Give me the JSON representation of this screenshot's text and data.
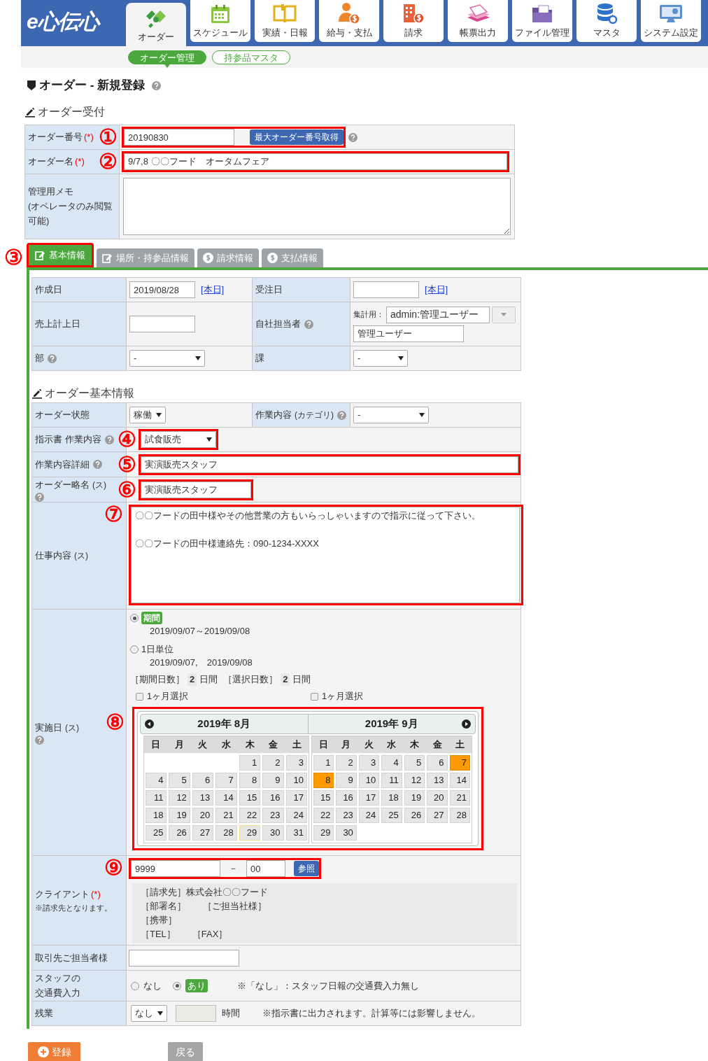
{
  "header": {
    "logo": "e心伝心",
    "nav": [
      {
        "label": "オーダー",
        "selected": true
      },
      {
        "label": "スケジュール",
        "selected": false
      },
      {
        "label": "実績・日報",
        "selected": false
      },
      {
        "label": "給与・支払",
        "selected": false
      },
      {
        "label": "請求",
        "selected": false
      },
      {
        "label": "帳票出力",
        "selected": false
      },
      {
        "label": "ファイル管理",
        "selected": false
      },
      {
        "label": "マスタ",
        "selected": false
      },
      {
        "label": "システム設定",
        "selected": false
      }
    ]
  },
  "subnav": [
    {
      "label": "オーダー管理",
      "selected": true
    },
    {
      "label": "持参品マスタ",
      "selected": false
    }
  ],
  "title": {
    "text": "オーダー - 新規登録",
    "help": true
  },
  "reception": {
    "heading": "オーダー受付",
    "rows": [
      {
        "kind": "number",
        "label": "オーダー番号",
        "required": "(*)",
        "callout": "①",
        "value": "20190830",
        "button": "最大オーダー番号取得",
        "value_help": true
      },
      {
        "kind": "input",
        "label": "オーダー名",
        "required": "(*)",
        "callout": "②",
        "value": "9/7,8 〇〇フード　オータムフェア"
      },
      {
        "kind": "textarea",
        "label": [
          "管理用メモ",
          "(オペレータのみ閲覧",
          "可能)"
        ]
      }
    ]
  },
  "tabs": [
    {
      "label": "基本情報",
      "selected": true,
      "kind": "edit",
      "callout": "③"
    },
    {
      "label": "場所・持参品情報",
      "selected": false,
      "kind": "edit"
    },
    {
      "label": "請求情報",
      "selected": false,
      "kind": "money"
    },
    {
      "label": "支払情報",
      "selected": false,
      "kind": "money"
    }
  ],
  "basic": {
    "rows": [
      [
        {
          "label": "作成日",
          "field": {
            "kind": "date",
            "value": "2019/08/28",
            "link": "[本日]"
          }
        },
        {
          "label": "受注日",
          "field": {
            "kind": "date",
            "link": "[本日]"
          }
        }
      ],
      [
        {
          "label": "売上計上日",
          "field": {
            "kind": "input"
          }
        },
        {
          "label": "自社担当者",
          "help": true,
          "field": {
            "kind": "staff",
            "prefix": "集計用：",
            "select": "admin:管理ユーザー",
            "value": "管理ユーザー"
          }
        }
      ],
      [
        {
          "label": "部",
          "help": true,
          "field": {
            "kind": "select",
            "value": "-"
          }
        },
        {
          "label": "課",
          "field": {
            "kind": "select",
            "value": "-"
          }
        }
      ]
    ]
  },
  "detail": {
    "heading": "オーダー基本情報",
    "rows": [
      {
        "kind": "pair",
        "cells": [
          {
            "label": "オーダー状態",
            "field": {
              "kind": "select",
              "value": "稼働"
            }
          },
          {
            "label": "作業内容",
            "note": "(カテゴリ)",
            "help": true,
            "field": {
              "kind": "select",
              "value": "-"
            }
          }
        ]
      },
      {
        "kind": "select",
        "label": "指示書 作業内容",
        "help": true,
        "callout": "④",
        "value": "試食販売"
      },
      {
        "kind": "input",
        "label": "作業内容詳細",
        "help": true,
        "callout": "⑤",
        "value": "実演販売スタッフ"
      },
      {
        "kind": "input",
        "label": "オーダー略名",
        "note": "(ス)",
        "help": true,
        "callout": "⑥",
        "value": "実演販売スタッフ"
      },
      {
        "kind": "textarea",
        "label": "仕事内容",
        "note": "(ス)",
        "callout": "⑦",
        "lines": [
          "〇〇フードの田中様やその他営業の方もいらっしゃいますので指示に従って下さい。",
          "〇〇フードの田中様連絡先：090-1234-XXXX"
        ]
      },
      {
        "kind": "schedule",
        "label": "実施日",
        "note": "(ス)",
        "help": true,
        "callout": "⑧",
        "options": [
          {
            "label": "期間",
            "selected": true,
            "dates": "2019/09/07～2019/09/08"
          },
          {
            "label": "1日単位",
            "selected": false,
            "dates": "2019/09/07,　2019/09/08"
          }
        ],
        "counts": [
          {
            "label": "［期間日数］",
            "value": "2",
            "unit": "日間"
          },
          {
            "label": "［選択日数］",
            "value": "2",
            "unit": "日間"
          }
        ],
        "month_checks": [
          {
            "label": "1ヶ月選択",
            "checked": false
          },
          {
            "label": "1ヶ月選択",
            "checked": false
          }
        ],
        "calendar": {
          "months": [
            {
              "title": "2019年 8月",
              "weekdays": [
                "日",
                "月",
                "火",
                "水",
                "木",
                "金",
                "土"
              ],
              "weeks": [
                {
                  "right_aligned": true,
                  "days": [
                    {
                      "d": "1",
                      "selected": false,
                      "today": false
                    },
                    {
                      "d": "2",
                      "selected": false,
                      "today": false
                    },
                    {
                      "d": "3",
                      "selected": false,
                      "today": false
                    }
                  ]
                },
                {
                  "days": [
                    {
                      "d": "4",
                      "selected": false,
                      "today": false
                    },
                    {
                      "d": "5",
                      "selected": false,
                      "today": false
                    },
                    {
                      "d": "6",
                      "selected": false,
                      "today": false
                    },
                    {
                      "d": "7",
                      "selected": false,
                      "today": false
                    },
                    {
                      "d": "8",
                      "selected": false,
                      "today": false
                    },
                    {
                      "d": "9",
                      "selected": false,
                      "today": false
                    },
                    {
                      "d": "10",
                      "selected": false,
                      "today": false
                    }
                  ]
                },
                {
                  "days": [
                    {
                      "d": "11",
                      "selected": false,
                      "today": false
                    },
                    {
                      "d": "12",
                      "selected": false,
                      "today": false
                    },
                    {
                      "d": "13",
                      "selected": false,
                      "today": false
                    },
                    {
                      "d": "14",
                      "selected": false,
                      "today": false
                    },
                    {
                      "d": "15",
                      "selected": false,
                      "today": false
                    },
                    {
                      "d": "16",
                      "selected": false,
                      "today": false
                    },
                    {
                      "d": "17",
                      "selected": false,
                      "today": false
                    }
                  ]
                },
                {
                  "days": [
                    {
                      "d": "18",
                      "selected": false,
                      "today": false
                    },
                    {
                      "d": "19",
                      "selected": false,
                      "today": false
                    },
                    {
                      "d": "20",
                      "selected": false,
                      "today": false
                    },
                    {
                      "d": "21",
                      "selected": false,
                      "today": false
                    },
                    {
                      "d": "22",
                      "selected": false,
                      "today": false
                    },
                    {
                      "d": "23",
                      "selected": false,
                      "today": false
                    },
                    {
                      "d": "24",
                      "selected": false,
                      "today": false
                    }
                  ]
                },
                {
                  "days": [
                    {
                      "d": "25",
                      "selected": false,
                      "today": false
                    },
                    {
                      "d": "26",
                      "selected": false,
                      "today": false
                    },
                    {
                      "d": "27",
                      "selected": false,
                      "today": false
                    },
                    {
                      "d": "28",
                      "selected": false,
                      "today": false
                    },
                    {
                      "d": "29",
                      "selected": false,
                      "today": true
                    },
                    {
                      "d": "30",
                      "selected": false,
                      "today": false
                    },
                    {
                      "d": "31",
                      "selected": false,
                      "today": false
                    }
                  ]
                }
              ]
            },
            {
              "title": "2019年 9月",
              "weekdays": [
                "日",
                "月",
                "火",
                "水",
                "木",
                "金",
                "土"
              ],
              "weeks": [
                {
                  "days": [
                    {
                      "d": "1",
                      "selected": false,
                      "today": false
                    },
                    {
                      "d": "2",
                      "selected": false,
                      "today": false
                    },
                    {
                      "d": "3",
                      "selected": false,
                      "today": false
                    },
                    {
                      "d": "4",
                      "selected": false,
                      "today": false
                    },
                    {
                      "d": "5",
                      "selected": false,
                      "today": false
                    },
                    {
                      "d": "6",
                      "selected": false,
                      "today": false
                    },
                    {
                      "d": "7",
                      "selected": true,
                      "today": false
                    }
                  ]
                },
                {
                  "days": [
                    {
                      "d": "8",
                      "selected": true,
                      "today": false
                    },
                    {
                      "d": "9",
                      "selected": false,
                      "today": false
                    },
                    {
                      "d": "10",
                      "selected": false,
                      "today": false
                    },
                    {
                      "d": "11",
                      "selected": false,
                      "today": false
                    },
                    {
                      "d": "12",
                      "selected": false,
                      "today": false
                    },
                    {
                      "d": "13",
                      "selected": false,
                      "today": false
                    },
                    {
                      "d": "14",
                      "selected": false,
                      "today": false
                    }
                  ]
                },
                {
                  "days": [
                    {
                      "d": "15",
                      "selected": false,
                      "today": false
                    },
                    {
                      "d": "16",
                      "selected": false,
                      "today": false
                    },
                    {
                      "d": "17",
                      "selected": false,
                      "today": false
                    },
                    {
                      "d": "18",
                      "selected": false,
                      "today": false
                    },
                    {
                      "d": "19",
                      "selected": false,
                      "today": false
                    },
                    {
                      "d": "20",
                      "selected": false,
                      "today": false
                    },
                    {
                      "d": "21",
                      "selected": false,
                      "today": false
                    }
                  ]
                },
                {
                  "days": [
                    {
                      "d": "22",
                      "selected": false,
                      "today": false
                    },
                    {
                      "d": "23",
                      "selected": false,
                      "today": false
                    },
                    {
                      "d": "24",
                      "selected": false,
                      "today": false
                    },
                    {
                      "d": "25",
                      "selected": false,
                      "today": false
                    },
                    {
                      "d": "26",
                      "selected": false,
                      "today": false
                    },
                    {
                      "d": "27",
                      "selected": false,
                      "today": false
                    },
                    {
                      "d": "28",
                      "selected": false,
                      "today": false
                    }
                  ]
                },
                {
                  "right_aligned": false,
                  "days": [
                    {
                      "d": "29",
                      "selected": false,
                      "today": false
                    },
                    {
                      "d": "30",
                      "selected": false,
                      "today": false
                    }
                  ]
                }
              ]
            }
          ]
        }
      },
      {
        "kind": "client",
        "label": "クライアント",
        "required": "(*)",
        "sub": "※請求先となります。",
        "callout": "⑨",
        "code": "9999",
        "separator": "－",
        "branch": "00",
        "button": "参照",
        "info": [
          [
            "［請求先］株式会社〇〇フード"
          ],
          [
            "［部署名］",
            "［ご担当社様］"
          ],
          [
            "［携帯］"
          ],
          [
            "［TEL］",
            "［FAX］"
          ]
        ]
      },
      {
        "kind": "input",
        "label": "取引先ご担当者様"
      },
      {
        "kind": "radio",
        "label": [
          "スタッフの",
          "交通費入力"
        ],
        "options": [
          {
            "label": "なし",
            "selected": false
          },
          {
            "label": "あり",
            "selected": true
          }
        ],
        "remark": "※「なし」：スタッフ日報の交通費入力無し"
      },
      {
        "kind": "overtime",
        "label": "残業",
        "select": "なし",
        "unit": "時間",
        "remark": "※指示書に出力されます。計算等には影響しません。"
      }
    ]
  },
  "buttons": [
    {
      "label": "登録",
      "kind": "primary"
    },
    {
      "label": "戻る",
      "kind": "secondary"
    }
  ]
}
